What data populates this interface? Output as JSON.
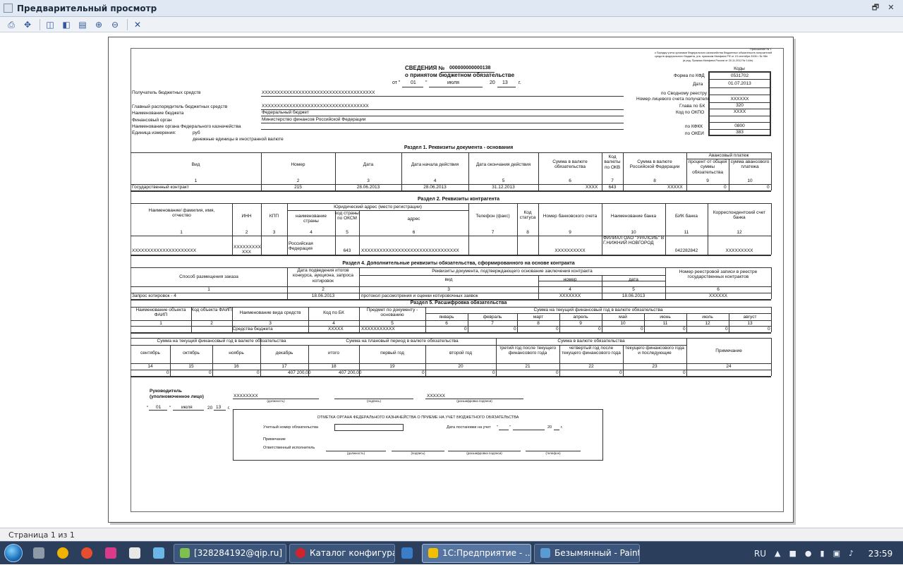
{
  "window": {
    "title": "Предварительный просмотр",
    "restore_glyph": "🗗",
    "close_glyph": "✕"
  },
  "toolbar": {
    "icons": [
      "print-icon",
      "move-icon",
      "fit-page-icon",
      "fit-width-icon",
      "page-area-icon",
      "zoom-in-icon",
      "zoom-out-icon",
      "close-icon"
    ]
  },
  "status": {
    "page": "Страница 1 из 1"
  },
  "doc": {
    "header_note": [
      "Приложение № 1",
      "к Порядку учета органами Федерального казначейства бюджетных обязательств получателей",
      "средств федерального бюджета, утв. приказом Минфина РФ от 19 сентября 2008 г. № 98н",
      "(в ред. Приказа Минфина России от 20.11.2012 № 144н)"
    ],
    "title1": "СВЕДЕНИЯ №",
    "number": "000000000000138",
    "title2": "о принятом бюджетном обязательстве",
    "date_ot": "от \"",
    "date_day": "01",
    "date_q": "\"",
    "date_month": "июля",
    "date_yr_pre": "20",
    "date_yr": "13",
    "date_g": "г.",
    "codes_header": "Коды",
    "codes": [
      {
        "label": "Форма по КФД",
        "value": "0531702"
      },
      {
        "label": "Дата",
        "value": "01.07.2013"
      },
      {
        "label": "по Сводному реестру",
        "value": ""
      },
      {
        "label": "Номер лицевого счета получателя",
        "value": "XXXXXX"
      },
      {
        "label": "Глава по БК",
        "value": "320"
      },
      {
        "label": "Код по ОКПО",
        "value": "XXXX"
      },
      {
        "label": "по КФКК",
        "value": "0800"
      },
      {
        "label": "по ОКЕИ",
        "value": "383"
      }
    ],
    "info_labels": [
      "Получатель бюджетных средств",
      "Главный распорядитель бюджетных средств",
      "Наименование бюджета",
      "Финансовый орган",
      "Наименование органа Федерального казначейства",
      "Единица измерения:",
      "денежные единицы в иностранной валюте"
    ],
    "info_values": [
      "XXXXXXXXXXXXXXXXXXXXXXXXXXXXXXXXXXXXX",
      "XXXXXXXXXXXXXXXXXXXXXXXXXXXXXXXXXXX",
      "Федеральный бюджет",
      "Министерство финансов Российской Федерации",
      "",
      "руб"
    ],
    "s1": {
      "title": "Раздел 1. Реквизиты документа - основания",
      "headers": [
        "Вид",
        "Номер",
        "Дата",
        "Дата начала действия",
        "Дата окончания действия",
        "Сумма в валюте обязательства",
        "Код валюты по ОКВ",
        "Сумма в валюте Российской Федерации",
        "Авансовый платеж",
        "процент от общей суммы обязательства",
        "сумма авансового платежа"
      ],
      "nums": [
        "1",
        "2",
        "3",
        "4",
        "5",
        "6",
        "7",
        "8",
        "9",
        "10"
      ],
      "row": [
        "Государственный контракт",
        "215",
        "28.06.2013",
        "28.06.2013",
        "31.12.2013",
        "XXXX",
        "643",
        "XXXXX",
        "0",
        "0"
      ]
    },
    "s2": {
      "title": "Раздел 2. Реквизиты контрагента",
      "headers": [
        "Наименование/ фамилия, имя, отчество",
        "ИНН",
        "КПП",
        "Юридический адрес (место регистрации)",
        "наименование страны",
        "код страны по ОКСМ",
        "адрес",
        "Телефон (факс)",
        "Код статуса",
        "Номер банковского счета",
        "Наименование банка",
        "БИК банка",
        "Корреспондентский счет банка"
      ],
      "nums": [
        "1",
        "2",
        "3",
        "4",
        "5",
        "6",
        "7",
        "8",
        "9",
        "10",
        "11",
        "12"
      ],
      "row": [
        "XXXXXXXXXXXXXXXXXXXXX",
        "XXXXXXXXX XXX",
        "",
        "Российская Федерация",
        "643",
        "XXXXXXXXXXXXXXXXXXXXXXXXXXXXXXXX",
        "",
        "",
        "XXXXXXXXXX",
        "ФИЛИАЛ ОАО \"УРАЛСИБ\" В Г.НИЖНИЙ НОВГОРОД",
        "042282842",
        "XXXXXXXXX"
      ]
    },
    "s4": {
      "title": "Раздел 4. Дополнительные реквизиты обязательства, сформированного на основе контракта",
      "headers": [
        "Способ размещения заказа",
        "Дата подведения итогов конкурса, аукциона, запроса котировок",
        "Реквизиты документа, подтверждающего основание заключения контракта",
        "вид",
        "номер",
        "дата",
        "Номер реестровой записи в реестре государственных контрактов"
      ],
      "nums": [
        "1",
        "2",
        "3",
        "4",
        "5",
        "6"
      ],
      "row": [
        "Запрос котировок - 4",
        "18.06.2013",
        "протокол рассмотрения и оценки котировочных заявок",
        "XXXXXXX",
        "18.06.2013",
        "XXXXXX"
      ]
    },
    "s5": {
      "title": "Раздел 5. Расшифровка обязательства",
      "headers": [
        "Наименование объекта ФАИП",
        "Код объекта ФАИП",
        "Наименование вида средств",
        "Код по БК",
        "Предмет по документу - основанию",
        "Сумма на текущий финансовый год в валюте обязательства"
      ],
      "months": [
        "январь",
        "февраль",
        "март",
        "апрель",
        "май",
        "июнь",
        "июль",
        "август"
      ],
      "nums": [
        "1",
        "2",
        "3",
        "4",
        "5",
        "6",
        "7",
        "8",
        "9",
        "10",
        "11",
        "12",
        "13"
      ],
      "row": [
        "",
        "",
        "Средства бюджета",
        "XXXXX",
        "XXXXXXXXXXX",
        "0",
        "0",
        "0",
        "0",
        "0",
        "0",
        "0",
        "0"
      ],
      "headers2": [
        "Сумма на текущий финансовый год в валюте обязательства",
        "Сумма на плановый период в валюте обязательства",
        "Сумма в валюте обязательства",
        "сентябрь",
        "октябрь",
        "ноябрь",
        "декабрь",
        "итого",
        "первый год",
        "второй год",
        "третий год после текущего финансового года",
        "четвертый год после текущего финансового года",
        "текущего финансового года и последующие",
        "Примечание"
      ],
      "nums2": [
        "14",
        "15",
        "16",
        "17",
        "18",
        "19",
        "20",
        "21",
        "22",
        "23",
        "24"
      ],
      "row2": [
        "0",
        "0",
        "0",
        "407 200,00",
        "407 200,00",
        "0",
        "0",
        "0",
        "0",
        "0",
        ""
      ]
    },
    "sign": {
      "head": "Руководитель",
      "head2": "(уполномоченное лицо)",
      "name1": "XXXXXXXX",
      "name2": "XXXXXX",
      "cap1": "(должность)",
      "cap2": "(подпись)",
      "cap3": "(расшифровка подписи)",
      "d_day": "01",
      "d_month": "июля",
      "d_yr": "13"
    },
    "mark": {
      "title": "ОТМЕТКА ОРГАНА ФЕДЕРАЛЬНОГО КАЗНАЧЕЙСТВА О ПРИЕМЕ НА УЧЕТ БЮДЖЕТНОГО ОБЯЗАТЕЛЬСТВА",
      "acc": "Учетный номер обязательства",
      "date": "Дата постановки на учет",
      "note": "Примечание",
      "exec": "Ответственный исполнитель",
      "caps": [
        "(должность)",
        "(подпись)",
        "(расшифровка подписи)",
        "(телефон)"
      ]
    }
  },
  "taskbar": {
    "tasks": [
      "[328284192@qip.ru]",
      "Каталог конфигура...",
      "1С:Предприятие - ...",
      "Безымянный - Paint"
    ],
    "lang": "RU",
    "time": "23:59",
    "colors": {
      "bar": "#2b3f5c",
      "accent": "#5675a1"
    }
  }
}
